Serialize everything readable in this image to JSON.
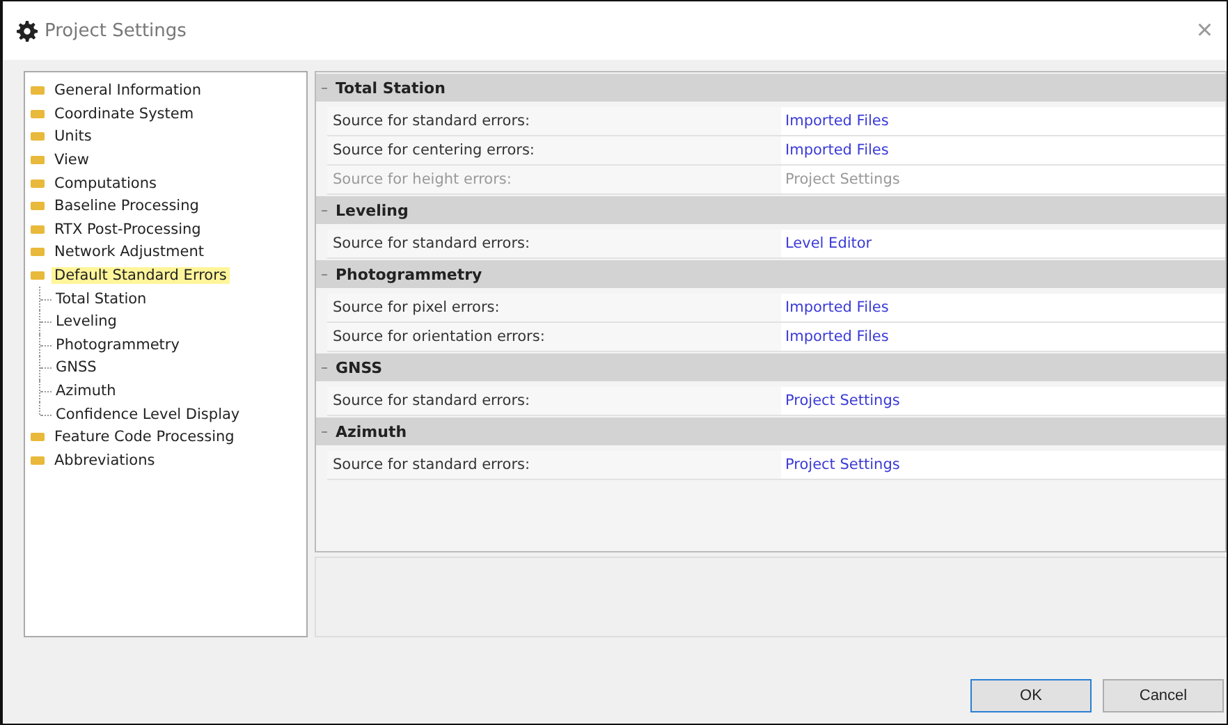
{
  "window": {
    "title": "Project Settings",
    "close": "×"
  },
  "tree": [
    {
      "label": "General Information",
      "selected": false
    },
    {
      "label": "Coordinate System",
      "selected": false
    },
    {
      "label": "Units",
      "selected": false
    },
    {
      "label": "View",
      "selected": false
    },
    {
      "label": "Computations",
      "selected": false
    },
    {
      "label": "Baseline Processing",
      "selected": false
    },
    {
      "label": "RTX Post-Processing",
      "selected": false
    },
    {
      "label": "Network Adjustment",
      "selected": false
    },
    {
      "label": "Default Standard Errors",
      "selected": true,
      "children": [
        {
          "label": "Total Station",
          "selected": false
        },
        {
          "label": "Leveling",
          "selected": false
        },
        {
          "label": "Photogrammetry",
          "selected": false
        },
        {
          "label": "GNSS",
          "selected": false
        },
        {
          "label": "Azimuth",
          "selected": false
        },
        {
          "label": "Confidence Level Display",
          "selected": false
        }
      ]
    },
    {
      "label": "Feature Code Processing",
      "selected": false
    },
    {
      "label": "Abbreviations",
      "selected": false
    }
  ],
  "sections": [
    {
      "title": "Total Station",
      "expanded": true,
      "rows": [
        {
          "label": "Source for standard errors:",
          "value": "Imported Files",
          "disabled": false
        },
        {
          "label": "Source for centering errors:",
          "value": "Imported Files",
          "disabled": false
        },
        {
          "label": "Source for height errors:",
          "value": "Project Settings",
          "disabled": true
        }
      ]
    },
    {
      "title": "Leveling",
      "expanded": true,
      "rows": [
        {
          "label": "Source for standard errors:",
          "value": "Level Editor",
          "disabled": false
        }
      ]
    },
    {
      "title": "Photogrammetry",
      "expanded": true,
      "rows": [
        {
          "label": "Source for pixel errors:",
          "value": "Imported Files",
          "disabled": false
        },
        {
          "label": "Source for orientation errors:",
          "value": "Imported Files",
          "disabled": false
        }
      ]
    },
    {
      "title": "GNSS",
      "expanded": true,
      "rows": [
        {
          "label": "Source for standard errors:",
          "value": "Project Settings",
          "disabled": false
        }
      ]
    },
    {
      "title": "Azimuth",
      "expanded": true,
      "rows": [
        {
          "label": "Source for standard errors:",
          "value": "Project Settings",
          "disabled": false
        }
      ]
    }
  ],
  "buttons": [
    {
      "label": "OK",
      "default": true
    },
    {
      "label": "Cancel",
      "default": false
    }
  ]
}
